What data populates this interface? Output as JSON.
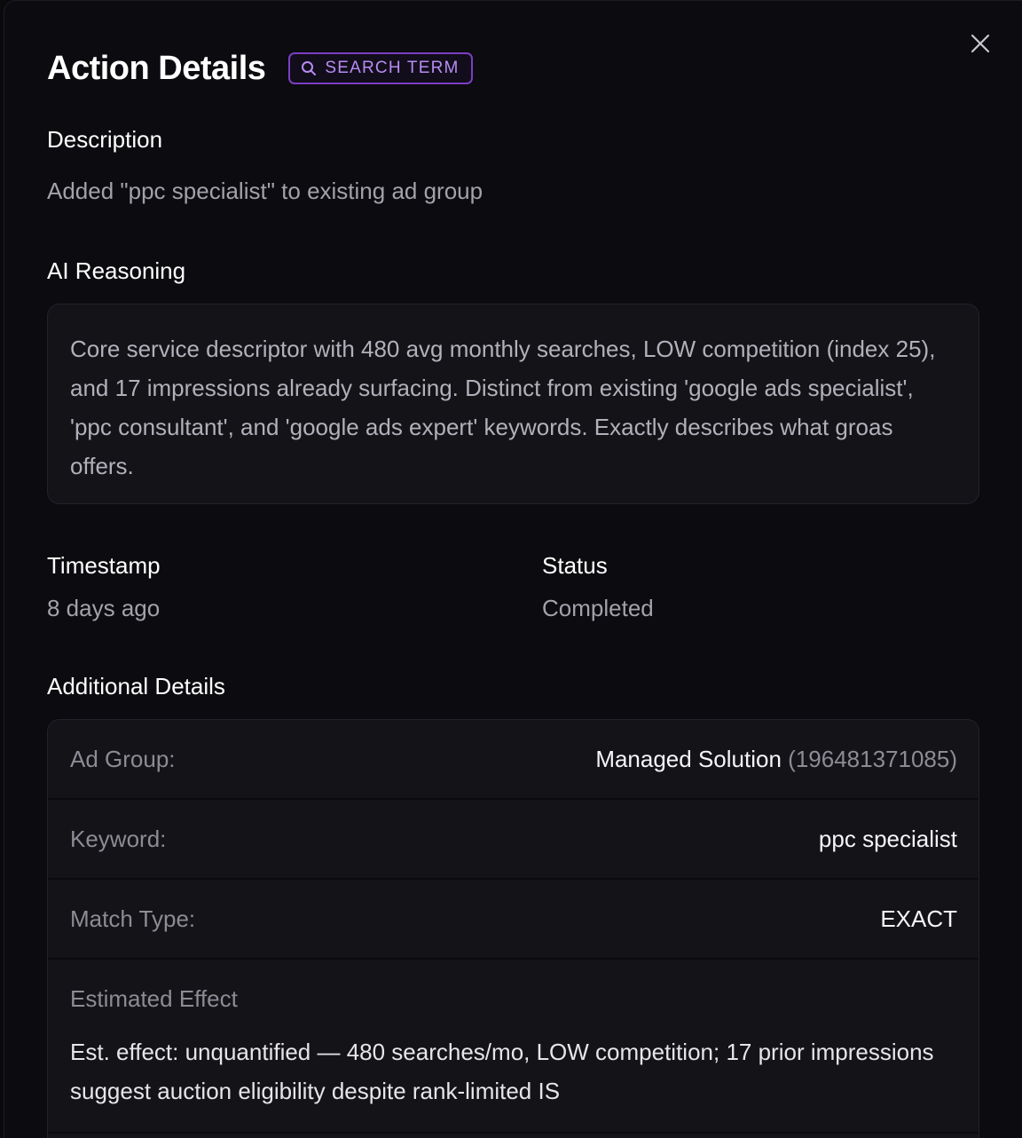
{
  "modal": {
    "title": "Action Details",
    "badge_label": "SEARCH TERM",
    "close_icon": "close-icon",
    "badge_icon": "search-icon"
  },
  "description": {
    "label": "Description",
    "text": "Added \"ppc specialist\" to existing ad group"
  },
  "reasoning": {
    "label": "AI Reasoning",
    "text": "Core service descriptor with 480 avg monthly searches, LOW competition (index 25), and 17 impressions already surfacing. Distinct from existing 'google ads specialist', 'ppc consultant', and 'google ads expert' keywords. Exactly describes what groas offers."
  },
  "timestamp": {
    "label": "Timestamp",
    "value": "8 days ago"
  },
  "status": {
    "label": "Status",
    "value": "Completed"
  },
  "additional": {
    "label": "Additional Details",
    "rows": [
      {
        "label": "Ad Group:",
        "value": "Managed Solution",
        "id": "(196481371085)"
      },
      {
        "label": "Keyword:",
        "value": "ppc specialist"
      },
      {
        "label": "Match Type:",
        "value": "EXACT"
      }
    ],
    "effect": {
      "title": "Estimated Effect",
      "text": "Est. effect: unquantified — 480 searches/mo, LOW competition; 17 prior impressions suggest auction eligibility despite rank-limited IS"
    }
  },
  "colors": {
    "background": "#0c0b0f",
    "accent": "#7c3ec4",
    "badge_text": "#b78cf3",
    "muted": "#a3a1aa"
  }
}
